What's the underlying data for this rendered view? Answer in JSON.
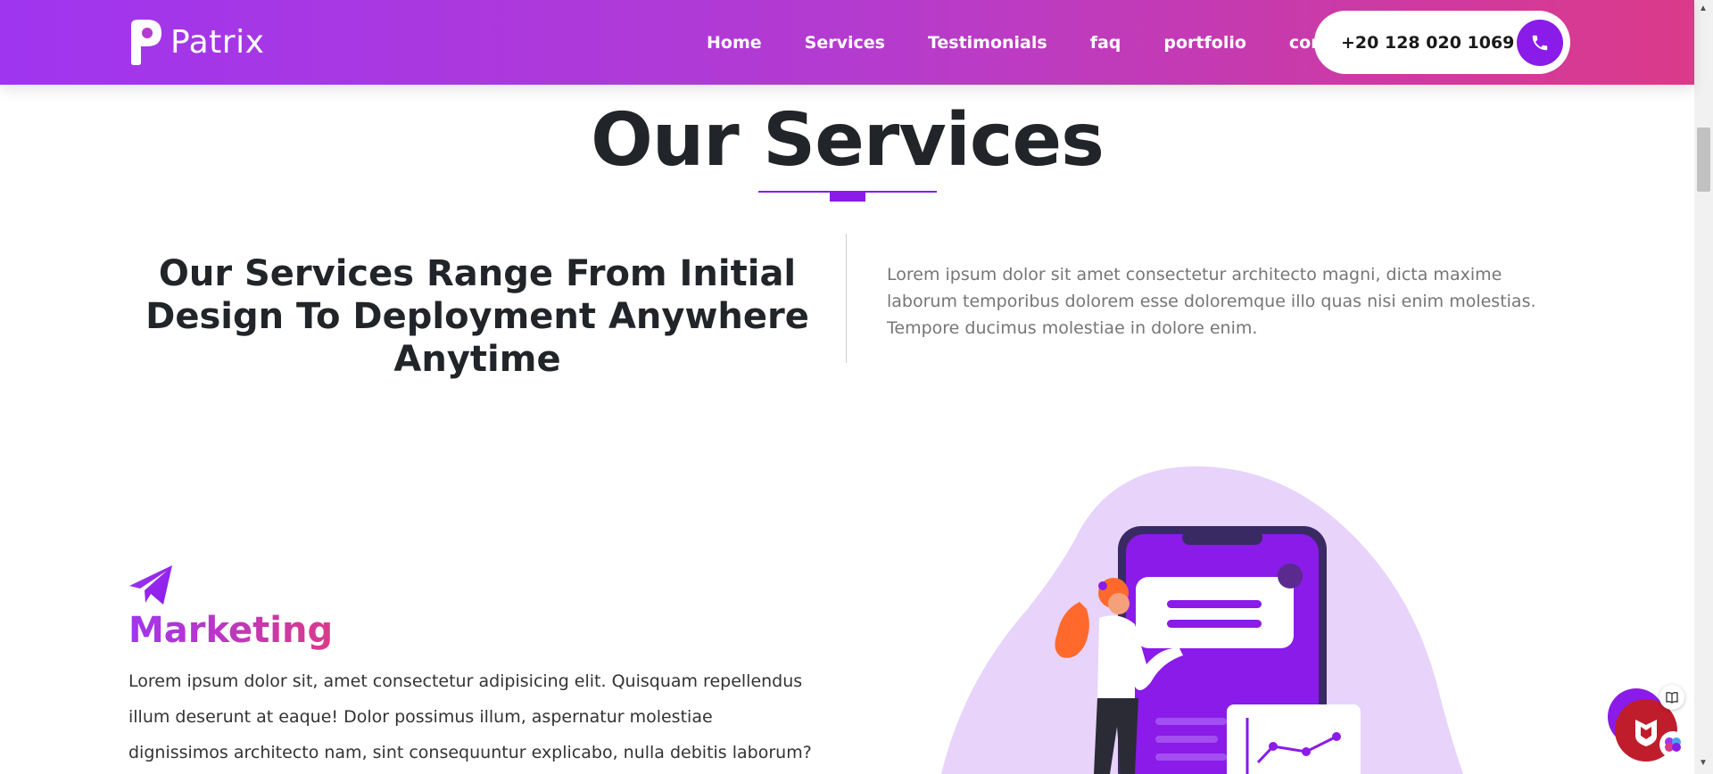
{
  "header": {
    "logo_text": "Patrix",
    "nav": [
      {
        "label": "Home"
      },
      {
        "label": "Services"
      },
      {
        "label": "Testimonials"
      },
      {
        "label": "faq"
      },
      {
        "label": "portfolio"
      },
      {
        "label": "contact"
      }
    ],
    "phone": "+20 128 020 1069",
    "phone_icon": "phone-icon"
  },
  "section": {
    "title": "Our Services",
    "intro_heading": "Our Services Range From Initial Design To Deployment Anywhere Anytime",
    "intro_text": "Lorem ipsum dolor sit amet consectetur architecto magni, dicta maxime laborum temporibus dolorem esse doloremque illo quas nisi enim molestias. Tempore ducimus molestiae in dolore enim."
  },
  "service": {
    "icon": "paper-plane-icon",
    "title": "Marketing",
    "text": "Lorem ipsum dolor sit, amet consectetur adipisicing elit. Quisquam repellendus illum deserunt at eaque! Dolor possimus illum, aspernatur molestiae dignissimos architecto nam, sint consequuntur explicabo, nulla debitis laborum?"
  },
  "colors": {
    "accent": "#8a1be8",
    "gradient_start": "#a035f0",
    "gradient_end": "#db3a89",
    "blob": "#e8d3fb"
  }
}
